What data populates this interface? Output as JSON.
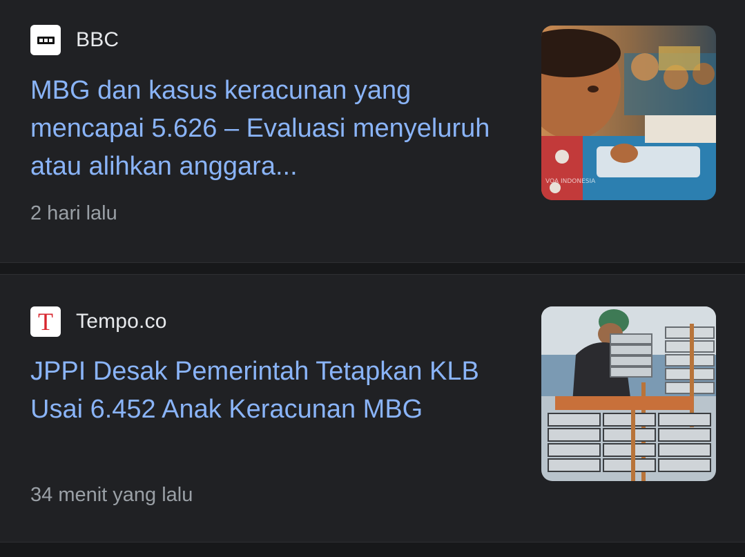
{
  "articles": [
    {
      "source": "BBC",
      "favicon_icon": "bbc-logo-icon",
      "headline": "MBG dan kasus keracunan yang mencapai 5.626 – Evaluasi menyeluruh atau alihkan anggara...",
      "time": "2 hari lalu",
      "thumbnail": "child-eating-school-meal-photo"
    },
    {
      "source": "Tempo.co",
      "favicon_icon": "tempo-logo-icon",
      "headline": "JPPI Desak Pemerintah Tetapkan KLB Usai 6.452 Anak Keracunan MBG",
      "time": "34 menit yang lalu",
      "thumbnail": "stacked-meal-trays-photo"
    }
  ],
  "colors": {
    "background": "#202124",
    "headline": "#8ab4f8",
    "source_text": "#e8eaed",
    "time_text": "#9aa0a6"
  }
}
